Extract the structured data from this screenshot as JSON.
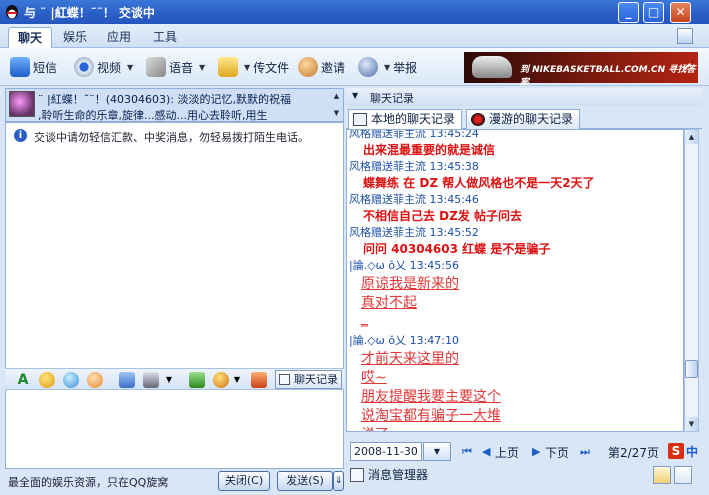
{
  "window": {
    "title": "与 ¨ |紅蝶！˜¨！ 交谈中",
    "min_label": "_",
    "max_label": "□",
    "close_label": "✕"
  },
  "menu": {
    "tabs": [
      "聊天",
      "娱乐",
      "应用",
      "工具"
    ]
  },
  "toolbar": {
    "sms": "短信",
    "video": "视频",
    "voice": "语音",
    "file": "传文件",
    "invite": "邀请",
    "report": "举报",
    "caret": "▼"
  },
  "banner": {
    "text": "到 NIKEBASKETBALL.COM.CN 寻找答案",
    "logo": "✔"
  },
  "contact": {
    "name_line": "¨ |紅蝶！˜¨！(40304603): 淡淡的记忆,默默的祝福",
    "signature_line": ",聆听生命的乐章,旋律...感动...用心去聆听,用生"
  },
  "chat": {
    "warning_icon": "i",
    "warning": "交谈中请勿轻信汇款、中奖消息，勿轻易拨打陌生电话。"
  },
  "input_toolbar": {
    "font_icon": "A",
    "history_label": "聊天记录"
  },
  "bottom": {
    "ad": "最全面的娱乐资源，只在QQ旋窝",
    "close": "关闭(C)",
    "send": "发送(S)",
    "send_arrow": "⇓"
  },
  "history": {
    "header": "聊天记录",
    "header_arrow": "▼",
    "tab_local": "本地的聊天记录",
    "tab_roam": "漫游的聊天记录",
    "messages": [
      {
        "sender": "风格赠送菲主流",
        "time": "13:45:24",
        "text": [
          "出来混最重要的就是诚信"
        ],
        "style": "bold"
      },
      {
        "sender": "风格赠送菲主流",
        "time": "13:45:38",
        "text": [
          "蝶舞练  在 DZ 帮人做风格也不是一天2天了"
        ],
        "style": "bold"
      },
      {
        "sender": "风格赠送菲主流",
        "time": "13:45:46",
        "text": [
          "不相信自己去 DZ发 帖子问去"
        ],
        "style": "bold"
      },
      {
        "sender": "风格赠送菲主流",
        "time": "13:45:52",
        "text": [
          "问问 40304603  红蝶 是不是骗子"
        ],
        "style": "bold"
      },
      {
        "sender": "|論.◇ω ŏ乂",
        "time": "13:45:56",
        "text": [
          "原谅我是新来的",
          "  真对不起",
          "_"
        ],
        "style": "pink"
      },
      {
        "sender": "|論.◇ω ŏ乂",
        "time": "13:47:10",
        "text": [
          "才前天来这里的",
          "  哎~",
          "  朋友提醒我要主要这个",
          "  说淘宝都有骗子一大堆",
          "  说了"
        ],
        "style": "pink"
      }
    ],
    "date": "2008-11-30",
    "date_btn": "▼",
    "prev": "上页",
    "next": "下页",
    "page": "第2/27页",
    "s_icon": "S",
    "lang": "中",
    "msg_manager": "消息管理器"
  }
}
